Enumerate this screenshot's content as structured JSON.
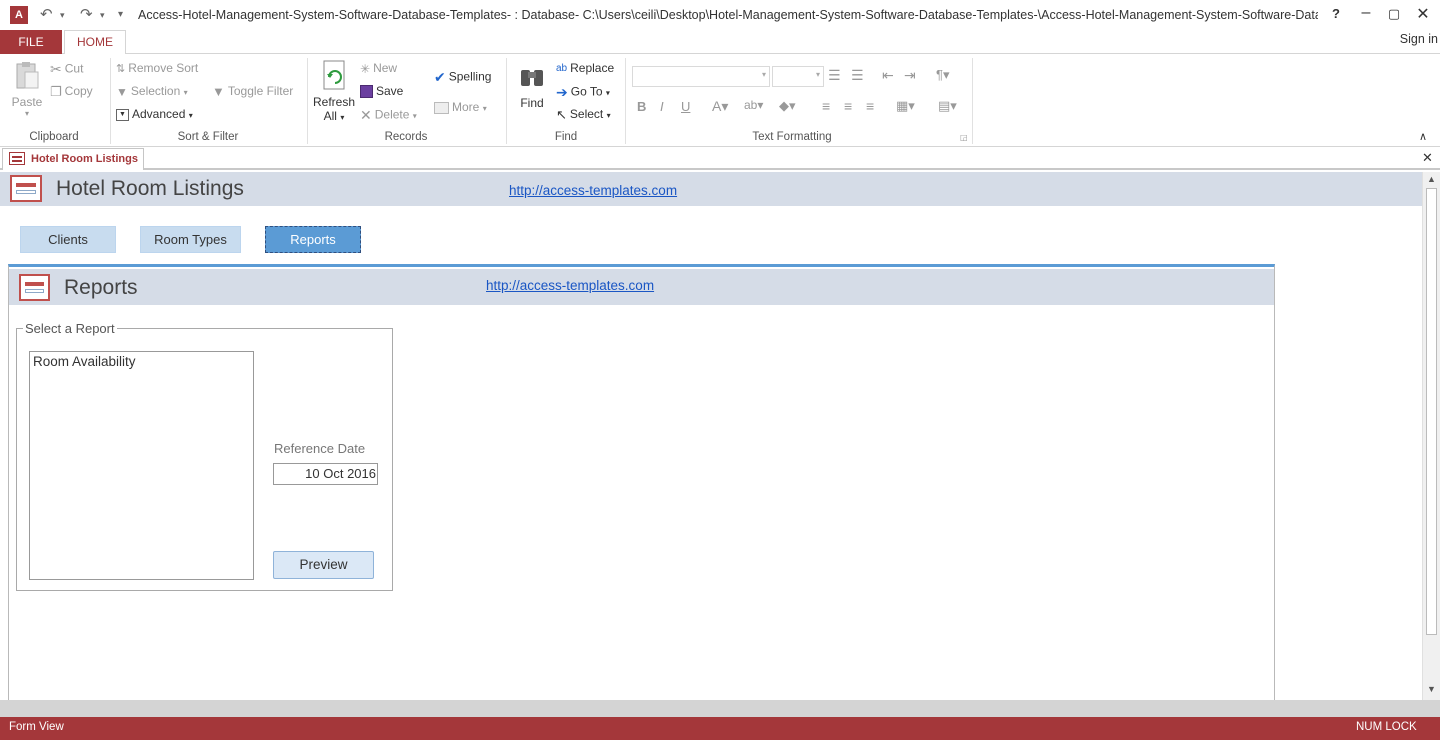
{
  "window": {
    "title": "Access-Hotel-Management-System-Software-Database-Templates- : Database- C:\\Users\\ceili\\Desktop\\Hotel-Management-System-Software-Database-Templates-\\Access-Hotel-Management-System-Software-Database-...",
    "help": "?",
    "sign_in": "Sign in"
  },
  "ribbon_tabs": {
    "file": "FILE",
    "home": "HOME"
  },
  "clipboard": {
    "paste": "Paste",
    "cut": "Cut",
    "copy": "Copy",
    "label": "Clipboard"
  },
  "sort_filter": {
    "remove_sort": "Remove Sort",
    "selection": "Selection",
    "advanced": "Advanced",
    "toggle_filter": "Toggle Filter",
    "label": "Sort & Filter"
  },
  "records": {
    "refresh": "Refresh",
    "refresh_all": "All",
    "new": "New",
    "save": "Save",
    "delete": "Delete",
    "spelling": "Spelling",
    "more": "More",
    "label": "Records"
  },
  "find": {
    "find": "Find",
    "replace": "Replace",
    "goto": "Go To",
    "select": "Select",
    "label": "Find"
  },
  "text_formatting": {
    "label": "Text Formatting",
    "bold": "B",
    "italic": "I",
    "underline": "U"
  },
  "doc_tab": {
    "label": "Hotel Room Listings"
  },
  "form": {
    "title": "Hotel Room Listings",
    "link": "http://access-templates.com",
    "nav": [
      {
        "label": "Clients"
      },
      {
        "label": "Room Types"
      },
      {
        "label": "Reports"
      }
    ],
    "subform": {
      "title": "Reports",
      "link": "http://access-templates.com",
      "group_label": "Select a Report",
      "reports": [
        "Room Availability"
      ],
      "ref_date_label": "Reference Date",
      "ref_date_value": "10 Oct 2016",
      "preview": "Preview"
    }
  },
  "status": {
    "left": "Form View",
    "right": "NUM LOCK"
  },
  "colors": {
    "access_red": "#a4373a",
    "header_blue": "#d5dce7",
    "tab_blue": "#c8dcef",
    "active_tab": "#5b9bd5"
  }
}
